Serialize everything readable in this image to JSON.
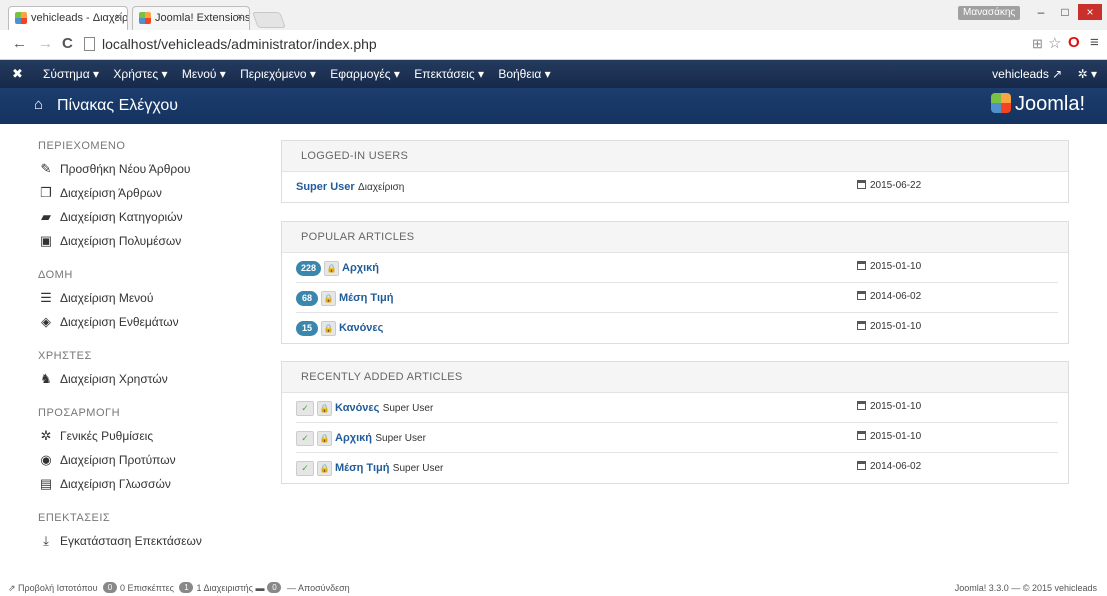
{
  "browser": {
    "tabs": [
      {
        "title": "vehicleads - Διαχείριση - |"
      },
      {
        "title": "Joomla! Extensions Direct"
      }
    ],
    "tab_close": "×",
    "user_badge": "Μανασάκης",
    "window_buttons": {
      "minimize": "–",
      "maximize": "□",
      "close": "×"
    },
    "url": "localhost/vehicleads/administrator/index.php",
    "nav": {
      "back": "←",
      "forward": "→",
      "reload": "C"
    },
    "toolbar_icons": {
      "translate": "⊞",
      "star": "☆",
      "opera": "O",
      "menu": "≡"
    }
  },
  "topnav": {
    "logo": "✖",
    "menu": [
      "Σύστημα ▾",
      "Χρήστες ▾",
      "Μενού ▾",
      "Περιεχόμενο ▾",
      "Εφαρμογές ▾",
      "Επεκτάσεις ▾",
      "Βοήθεια ▾"
    ],
    "site_link": "vehicleads ↗",
    "settings": "✲ ▾"
  },
  "subhead": {
    "home_icon": "⌂",
    "title": "Πίνακας Ελέγχου",
    "brand": "Joomla!"
  },
  "sidebar": {
    "sections": [
      {
        "title": "ΠΕΡΙΕΧΟΜΕΝΟ",
        "items": [
          {
            "icon": "✎",
            "icon_name": "pencil-icon",
            "label": "Προσθήκη Νέου Άρθρου"
          },
          {
            "icon": "❐",
            "icon_name": "articles-icon",
            "label": "Διαχείριση Άρθρων"
          },
          {
            "icon": "▰",
            "icon_name": "folder-icon",
            "label": "Διαχείριση Κατηγοριών"
          },
          {
            "icon": "▣",
            "icon_name": "image-icon",
            "label": "Διαχείριση Πολυμέσων"
          }
        ]
      },
      {
        "title": "ΔΟΜΗ",
        "items": [
          {
            "icon": "☰",
            "icon_name": "list-icon",
            "label": "Διαχείριση Μενού"
          },
          {
            "icon": "◈",
            "icon_name": "cube-icon",
            "label": "Διαχείριση Ενθεμάτων"
          }
        ]
      },
      {
        "title": "ΧΡΗΣΤΕΣ",
        "items": [
          {
            "icon": "♞",
            "icon_name": "users-icon",
            "label": "Διαχείριση Χρηστών"
          }
        ]
      },
      {
        "title": "ΠΡΟΣΑΡΜΟΓΗ",
        "items": [
          {
            "icon": "✲",
            "icon_name": "gear-icon",
            "label": "Γενικές Ρυθμίσεις"
          },
          {
            "icon": "◉",
            "icon_name": "eye-icon",
            "label": "Διαχείριση Προτύπων"
          },
          {
            "icon": "▤",
            "icon_name": "comments-icon",
            "label": "Διαχείριση Γλωσσών"
          }
        ]
      },
      {
        "title": "ΕΠΕΚΤΑΣΕΙΣ",
        "items": [
          {
            "icon": "⤓",
            "icon_name": "download-icon",
            "label": "Εγκατάσταση Επεκτάσεων"
          }
        ]
      }
    ]
  },
  "panels": {
    "logged_in": {
      "title": "LOGGED-IN USERS",
      "rows": [
        {
          "name": "Super User",
          "role": "Διαχείριση",
          "date": "2015-06-22"
        }
      ]
    },
    "popular": {
      "title": "POPULAR ARTICLES",
      "rows": [
        {
          "hits": "228",
          "title": "Αρχική",
          "date": "2015-01-10"
        },
        {
          "hits": "68",
          "title": "Μέση Τιμή",
          "date": "2014-06-02"
        },
        {
          "hits": "15",
          "title": "Κανόνες",
          "date": "2015-01-10"
        }
      ]
    },
    "recent": {
      "title": "RECENTLY ADDED ARTICLES",
      "rows": [
        {
          "title": "Κανόνες",
          "author": "Super User",
          "date": "2015-01-10"
        },
        {
          "title": "Αρχική",
          "author": "Super User",
          "date": "2015-01-10"
        },
        {
          "title": "Μέση Τιμή",
          "author": "Super User",
          "date": "2014-06-02"
        }
      ]
    },
    "lock_icon": "🔒",
    "check_icon": "✓"
  },
  "statusbar": {
    "view_site": "⇗ Προβολή Ιστοτόπου",
    "visitors_count": "0",
    "visitors_label": "0 Επισκέπτες",
    "admins_count": "1",
    "admins_label": "1 Διαχειριστής",
    "messages_icon": "▬",
    "messages_count": "0",
    "logout": "— Αποσύνδεση",
    "version": "Joomla! 3.3.0 — © 2015 vehicleads"
  },
  "colors": {
    "nav_bg": "#17294a",
    "header_bg": "#1c3d6e",
    "link": "#1f5c99",
    "hits_badge": "#3a87ad"
  }
}
